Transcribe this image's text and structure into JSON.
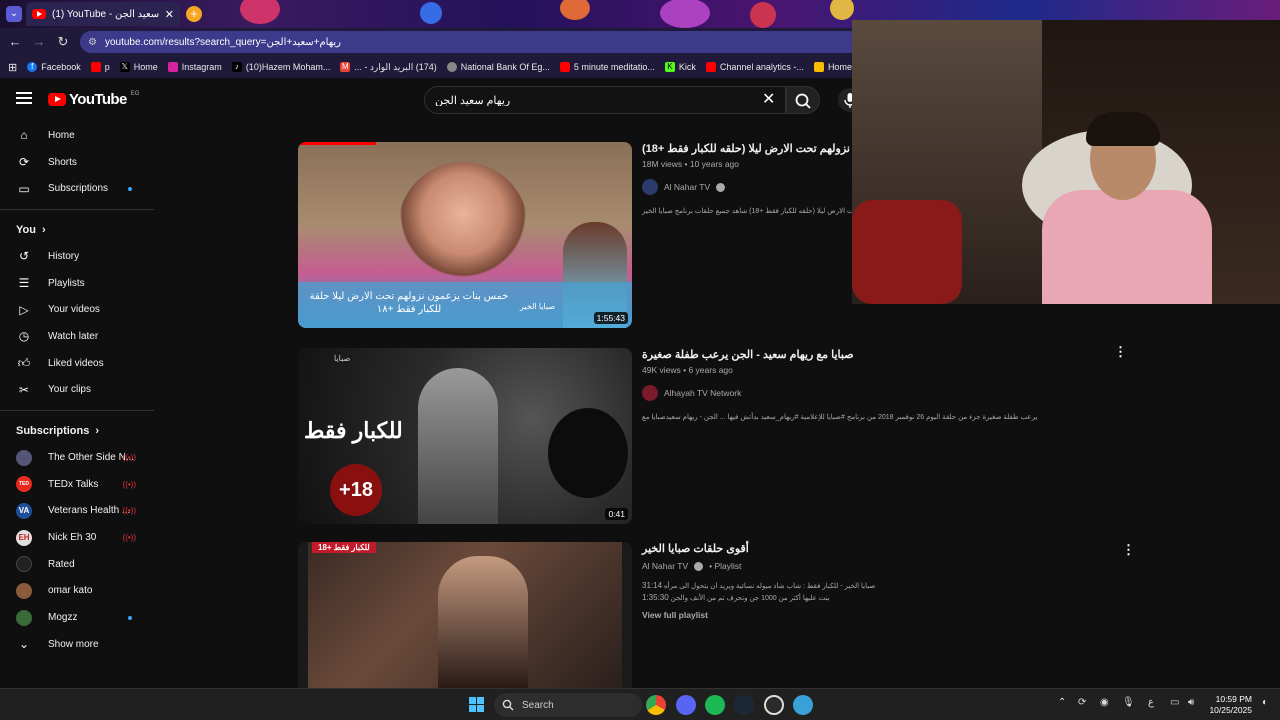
{
  "browser": {
    "tab_title": "(1) YouTube - ريهام سعيد الجن",
    "url": "youtube.com/results?search_query=ريهام+سعيد+الجن",
    "bookmarks": [
      {
        "label": "Facebook",
        "icon": "facebook-icon",
        "color": "#1877f2"
      },
      {
        "label": "p",
        "icon": "youtube-icon",
        "color": "#ff0000"
      },
      {
        "label": "Home",
        "icon": "x-icon",
        "color": "#000000"
      },
      {
        "label": "Instagram",
        "icon": "instagram-icon",
        "color": "#d6249f"
      },
      {
        "label": "(10)Hazem Moham...",
        "icon": "tiktok-icon",
        "color": "#000000"
      },
      {
        "label": "(174) البريد الوارد - ...",
        "icon": "gmail-icon",
        "color": "#ea4335"
      },
      {
        "label": "National Bank Of Eg...",
        "icon": "globe-icon",
        "color": "#888888"
      },
      {
        "label": "5 minute meditatio...",
        "icon": "youtube-icon",
        "color": "#ff0000"
      },
      {
        "label": "Kick",
        "icon": "kick-icon",
        "color": "#53fc18"
      },
      {
        "label": "Channel analytics -...",
        "icon": "youtube-icon",
        "color": "#ff0000"
      },
      {
        "label": "Home – Goo",
        "icon": "drive-icon",
        "color": "#fbbc04"
      }
    ]
  },
  "youtube": {
    "logo_text": "YouTube",
    "country_code": "EG",
    "search_value": "ريهام سعيد الجن",
    "sidebar": {
      "main": [
        {
          "label": "Home",
          "icon": "home-icon"
        },
        {
          "label": "Shorts",
          "icon": "shorts-icon"
        },
        {
          "label": "Subscriptions",
          "icon": "subscriptions-icon"
        }
      ],
      "you_heading": "You",
      "you": [
        {
          "label": "History",
          "icon": "history-icon"
        },
        {
          "label": "Playlists",
          "icon": "playlists-icon"
        },
        {
          "label": "Your videos",
          "icon": "your-videos-icon"
        },
        {
          "label": "Watch later",
          "icon": "watch-later-icon"
        },
        {
          "label": "Liked videos",
          "icon": "like-icon"
        },
        {
          "label": "Your clips",
          "icon": "scissors-icon"
        }
      ],
      "subs_heading": "Subscriptions",
      "subscriptions": [
        {
          "label": "The Other Side N...",
          "avatar_color": "#555577",
          "avatar_text": "",
          "badge": "live"
        },
        {
          "label": "TEDx Talks",
          "avatar_color": "#e62b1e",
          "avatar_text": "TED",
          "badge": "live"
        },
        {
          "label": "Veterans Health ...",
          "avatar_color": "#1f4e9a",
          "avatar_text": "VA",
          "badge": "live"
        },
        {
          "label": "Nick Eh 30",
          "avatar_color": "#e0e0e0",
          "avatar_text": "EH",
          "badge": "live"
        },
        {
          "label": "Rated",
          "avatar_color": "#222222",
          "avatar_text": "",
          "badge": ""
        },
        {
          "label": "omar kato",
          "avatar_color": "#8a5a3a",
          "avatar_text": "",
          "badge": ""
        },
        {
          "label": "Mogzz",
          "avatar_color": "#3a6a3a",
          "avatar_text": "",
          "badge": "dot"
        }
      ],
      "show_more": "Show more"
    },
    "results": [
      {
        "title": "خمس بنات يزعمون نزولهم تحت الارض ليلا (حلقه للكبار فقط +18)",
        "views": "18M views",
        "age": "10 years ago",
        "channel": "Al Nahar TV",
        "verified": true,
        "description": "خمس بنات يزعمون نزولهم تحت الارض ليلا (حلقه للكبار فقط +18) شاهد جميع حلقات برنامج صبايا الخير",
        "duration": "1:55:43",
        "thumb_caption": "خمس بنات يزعمون نزولهم تحت الارض ليلا حلقة للكبار فقط +١٨",
        "thumb_brand": "صبايا الخير"
      },
      {
        "title": "صبايا مع ريهام سعيد - الجن يرعب طفلة صغيرة",
        "views": "49K views",
        "age": "6 years ago",
        "channel": "Alhayah TV Network",
        "verified": false,
        "description": "يرعب طفلة صغيرة جزء من حلقة اليوم 26 نوفمبر 2018 من برنامج #صبايا للإعلامية #ريهام_سعيد بدأتش فيها ... الجن - ريهام سعيدصبايا مع",
        "duration": "0:41",
        "thumb_caption": "للكبار فقط",
        "thumb_badge": "+18",
        "thumb_brand": "صبايا"
      },
      {
        "title": "أقوى حلقات صبايا الخير",
        "channel": "Al Nahar TV",
        "verified": true,
        "kind": "Playlist",
        "items": [
          {
            "text": "صبايا الخير - للكبار فقط : شاب شاذ ميوله نسائية ويريد ان يتحول الى مرأه",
            "time": "31:14"
          },
          {
            "text": "بنت عليها أكثر من 1000 جن وتحرف تم من الأنف والجن",
            "time": "1:35:30"
          }
        ],
        "view_full": "View full playlist",
        "thumb_caption": "للكبار فقط +18"
      }
    ]
  },
  "taskbar": {
    "search_placeholder": "Search",
    "time": "10:59 PM",
    "date": "10/25/2025",
    "lang": "ع"
  }
}
